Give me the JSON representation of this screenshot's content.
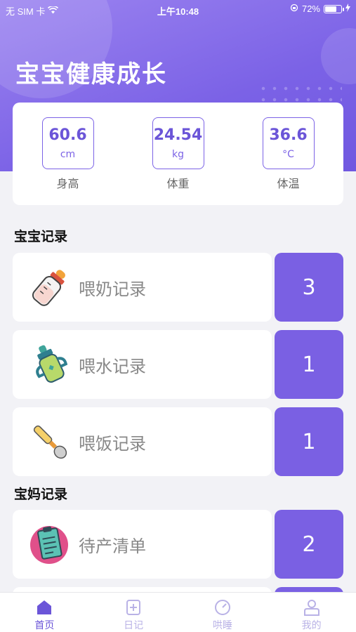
{
  "status_bar": {
    "carrier": "无 SIM 卡",
    "time": "上午10:48",
    "battery_percent": "72%",
    "battery_level": 0.72
  },
  "header": {
    "title": "宝宝健康成长"
  },
  "metrics": [
    {
      "value": "60.6",
      "unit": "cm",
      "label": "身高"
    },
    {
      "value": "24.54",
      "unit": "kg",
      "label": "体重"
    },
    {
      "value": "36.6",
      "unit": "°C",
      "label": "体温"
    }
  ],
  "sections": {
    "baby": "宝宝记录",
    "mom": "宝妈记录"
  },
  "records": [
    {
      "label": "喂奶记录",
      "count": "3",
      "icon": "baby-bottle-icon"
    },
    {
      "label": "喂水记录",
      "count": "1",
      "icon": "sippy-cup-icon"
    },
    {
      "label": "喂饭记录",
      "count": "1",
      "icon": "spoon-icon"
    },
    {
      "label": "待产清单",
      "count": "2",
      "icon": "clipboard-icon"
    }
  ],
  "tabs": [
    {
      "label": "首页",
      "icon": "home-icon",
      "active": true
    },
    {
      "label": "日记",
      "icon": "diary-add-icon",
      "active": false
    },
    {
      "label": "哄睡",
      "icon": "sleep-gauge-icon",
      "active": false
    },
    {
      "label": "我的",
      "icon": "profile-icon",
      "active": false
    }
  ],
  "colors": {
    "accent": "#7a60e3",
    "header_gradient_start": "#9b83f0",
    "tab_inactive": "#b9b2e6"
  }
}
